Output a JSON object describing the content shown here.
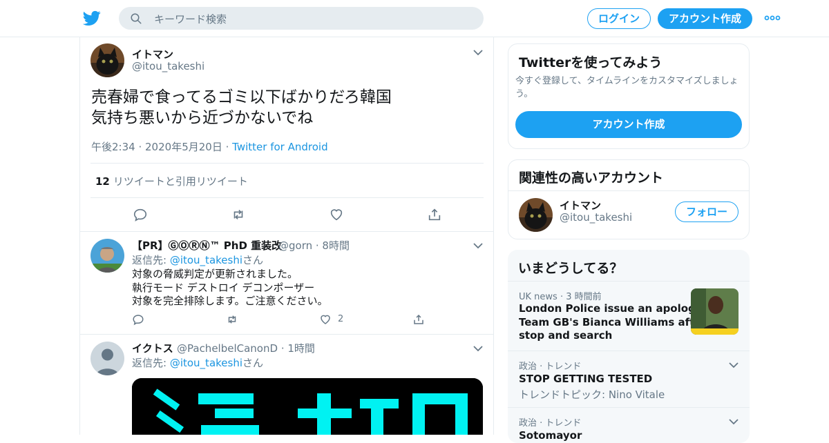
{
  "header": {
    "search_placeholder": "キーワード検索",
    "login_label": "ログイン",
    "signup_label": "アカウント作成"
  },
  "main_tweet": {
    "name": "イトマン",
    "handle": "@itou_takeshi",
    "text_line1": "売春婦で食ってるゴミ以下ばかりだろ韓国",
    "text_line2": "気持ち悪いから近づかないでね",
    "time": "午後2:34",
    "date": "2020年5月20日",
    "client": "Twitter for Android",
    "retweet_count": "12",
    "retweet_label": "リツイートと引用リツイート"
  },
  "replies": [
    {
      "name": "【PR】ⒼⓄⓇⓃ™ PhD 重装改",
      "handle": "@gorn",
      "time": "8時間",
      "reply_prefix": "返信先: ",
      "reply_handle": "@itou_takeshi",
      "reply_suffix": "さん",
      "lines": [
        "対象の脅威判定が更新されました。",
        "執行モード デストロイ デコンポーザー",
        "対象を完全排除します。ご注意ください。"
      ],
      "like_count": "2"
    },
    {
      "name": "イクトス",
      "handle": "@PachelbelCanonD",
      "time": "1時間",
      "reply_prefix": "返信先: ",
      "reply_handle": "@itou_takeshi",
      "reply_suffix": "さん"
    }
  ],
  "signup_card": {
    "title": "Twitterを使ってみよう",
    "subtitle": "今すぐ登録して、タイムラインをカスタマイズしましょう。",
    "button": "アカウント作成"
  },
  "related_card": {
    "title": "関連性の高いアカウント",
    "name": "イトマン",
    "handle": "@itou_takeshi",
    "follow": "フォロー"
  },
  "trends": {
    "title": "いまどうしてる？",
    "items": [
      {
        "meta": "UK news · 3 時間前",
        "title_lines": [
          "London Police issue an apology to",
          "Team GB's Bianca Williams after",
          "stop and search"
        ]
      },
      {
        "meta": "政治 · トレンド",
        "title": "STOP GETTING TESTED",
        "sub": "トレンドトピック: Nino Vitale"
      },
      {
        "meta": "政治 · トレンド",
        "title": "Sotomayor"
      }
    ]
  }
}
